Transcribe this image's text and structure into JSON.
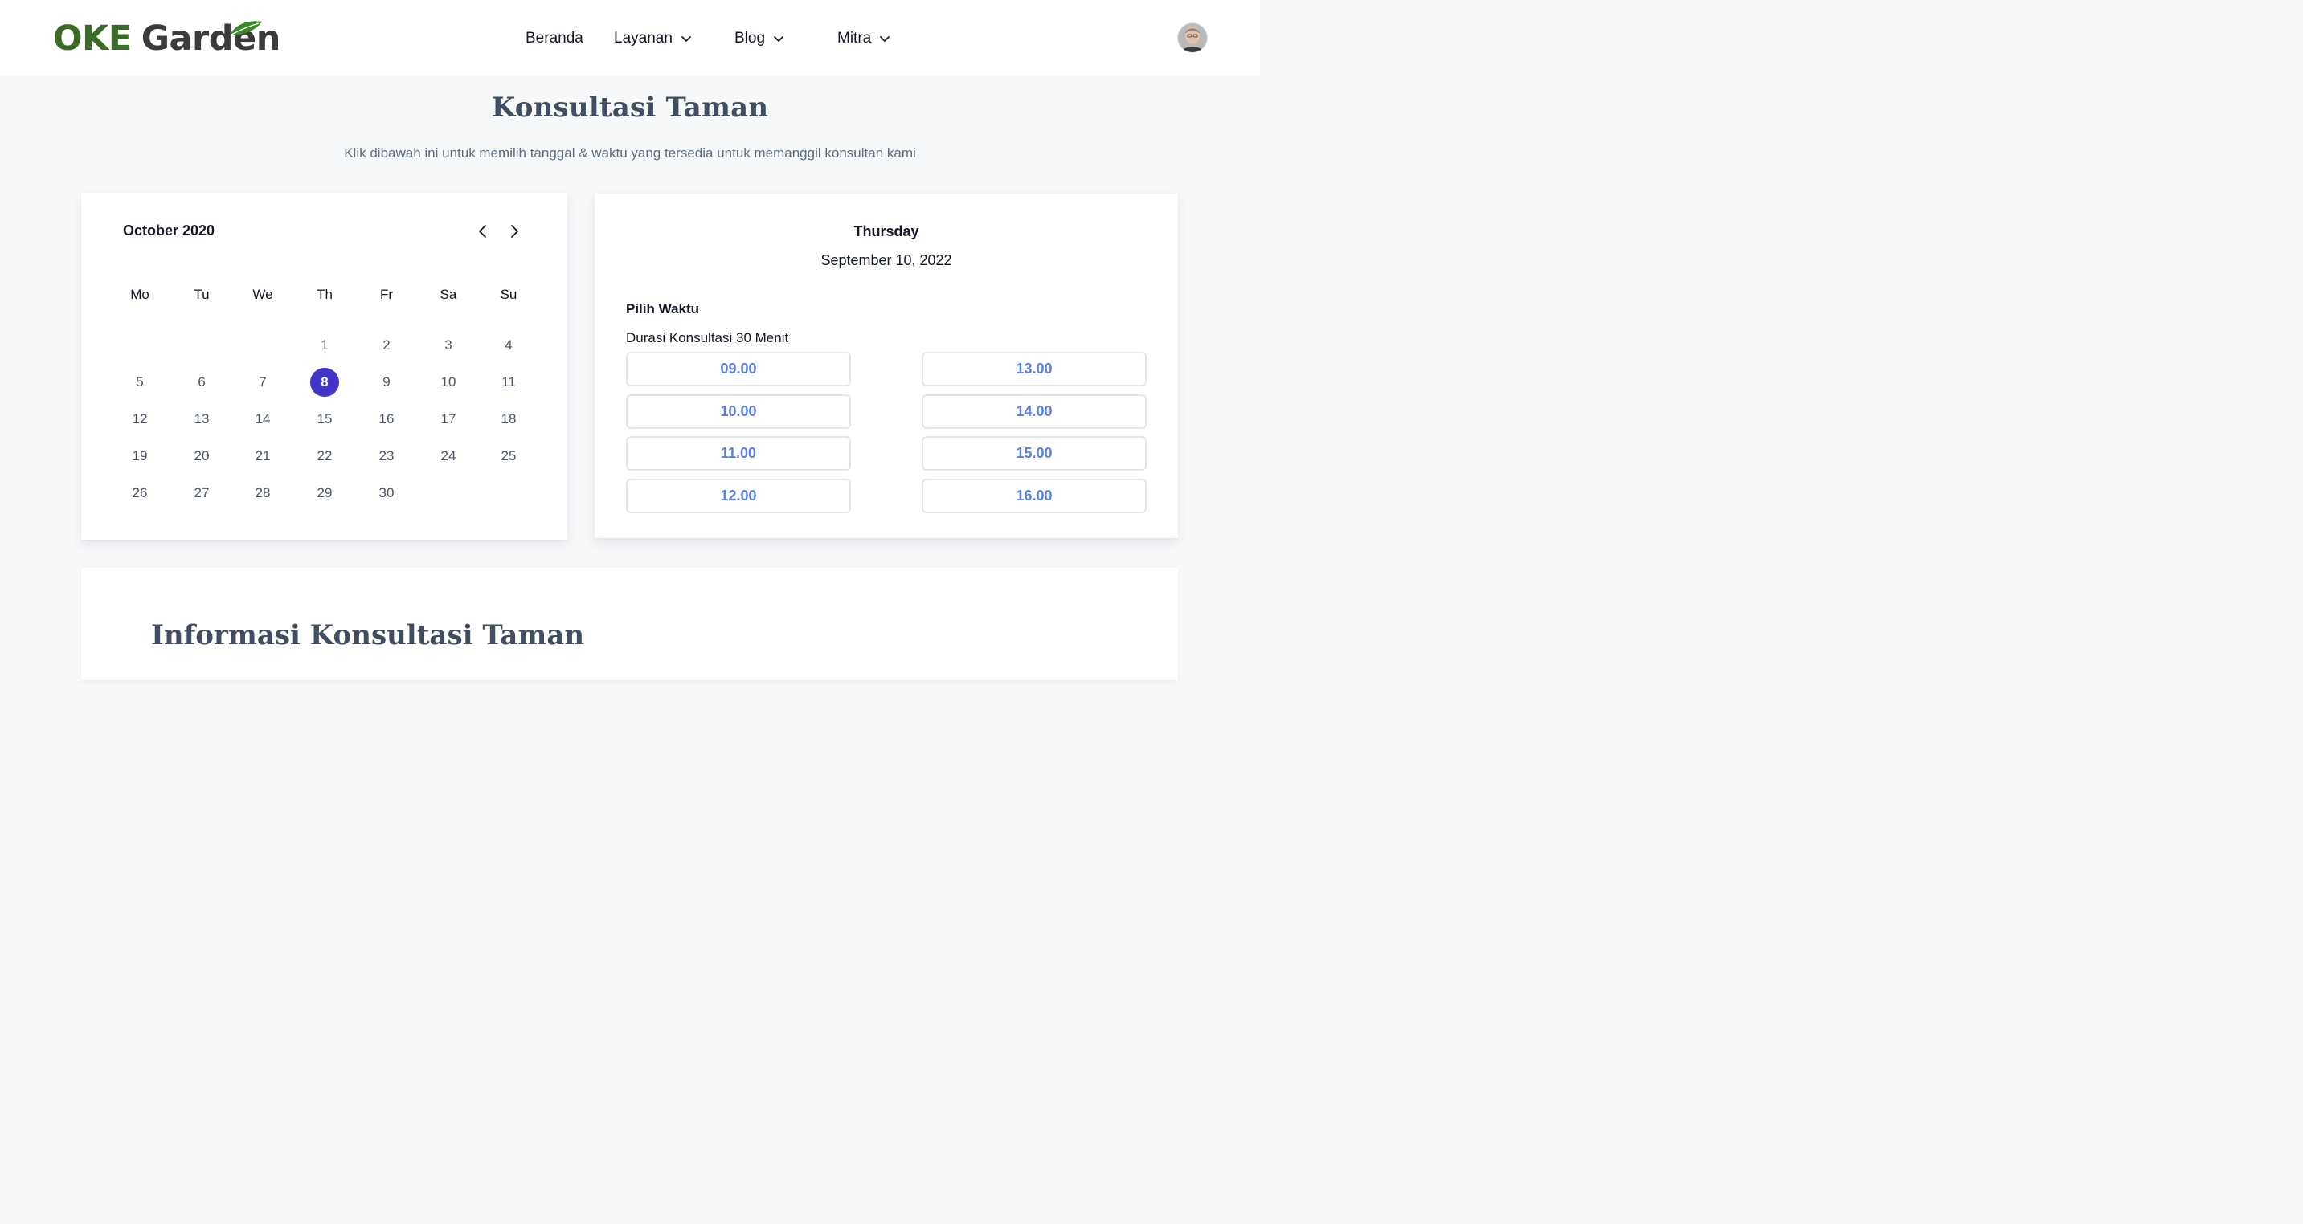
{
  "header": {
    "logo": {
      "part1": "OKE",
      "part2": "Garden"
    },
    "nav": [
      {
        "label": "Beranda"
      },
      {
        "label": "Layanan"
      },
      {
        "label": "Blog"
      },
      {
        "label": "Mitra"
      }
    ],
    "avatar_icon": "user-avatar"
  },
  "main": {
    "title": "Konsultasi Taman",
    "subtitle": "Klik dibawah ini untuk memilih tanggal & waktu yang tersedia untuk memanggil konsultan kami"
  },
  "calendar": {
    "month_label": "October 2020",
    "prev_icon": "chevron-left-icon",
    "next_icon": "chevron-right-icon",
    "weekdays": [
      "Mo",
      "Tu",
      "We",
      "Th",
      "Fr",
      "Sa",
      "Su"
    ],
    "days": [
      "1",
      "2",
      "3",
      "4",
      "5",
      "6",
      "7",
      "8",
      "9",
      "10",
      "11",
      "12",
      "13",
      "14",
      "15",
      "16",
      "17",
      "18",
      "19",
      "20",
      "21",
      "22",
      "23",
      "24",
      "25",
      "26",
      "27",
      "28",
      "29",
      "30"
    ],
    "selected_day": "8",
    "accent_color": "#4135c4"
  },
  "schedule": {
    "weekday": "Thursday",
    "date": "September 10, 2022",
    "pick_label": "Pilih Waktu",
    "duration": "Durasi Konsultasi 30 Menit",
    "slots": [
      "09.00",
      "10.00",
      "11.00",
      "12.00",
      "13.00",
      "14.00",
      "15.00",
      "16.00"
    ],
    "slot_color": "#5b7fdf"
  },
  "info": {
    "title": "Informasi Konsultasi Taman"
  }
}
